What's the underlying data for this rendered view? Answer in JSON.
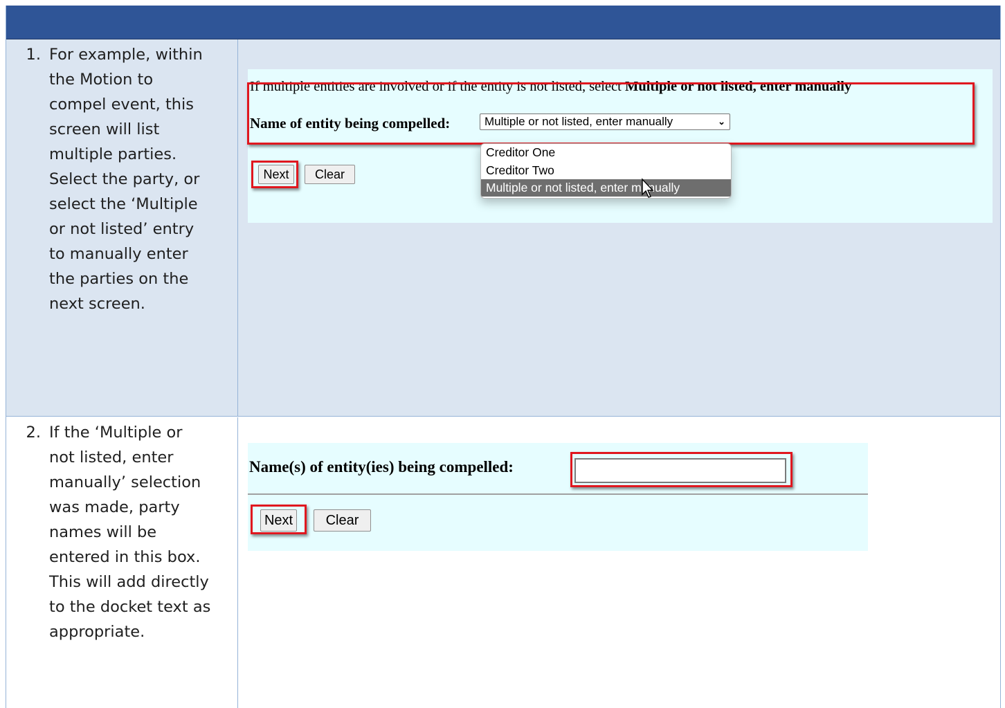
{
  "steps": [
    {
      "number": "1.",
      "text": "For example, within the Motion to compel event, this screen will list multiple parties. Select the party, or select the ‘Multiple or not listed’ entry to manually enter the parties on the next screen."
    },
    {
      "number": "2.",
      "text": "If the ‘Multiple or not listed, enter manually’ selection was made, party names will be entered in this box. This will add directly to the docket text as appropriate."
    }
  ],
  "screen1": {
    "instruction_prefix": "If multiple entities are involved or if the entity is not listed, select ",
    "instruction_bold": "Multiple or not listed, enter manually",
    "field_label": "Name of entity being compelled:",
    "selected_value": "Multiple or not listed, enter manually",
    "options": [
      "Creditor One",
      "Creditor Two",
      "Multiple or not listed, enter manually"
    ],
    "highlighted_option_index": 2,
    "next_label": "Next",
    "clear_label": "Clear"
  },
  "screen2": {
    "field_label": "Name(s) of entity(ies) being compelled:",
    "input_value": "",
    "next_label": "Next",
    "clear_label": "Clear"
  },
  "colors": {
    "header": "#2f5597",
    "row_bg": "#dbe5f1",
    "form_bg": "#e6fdff",
    "highlight_border": "#e0171f"
  }
}
